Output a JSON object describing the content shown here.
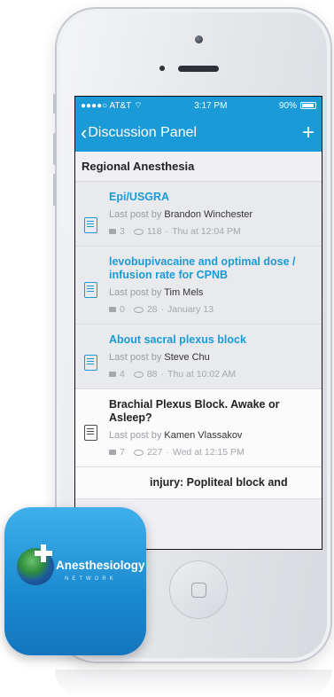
{
  "status_bar": {
    "carrier": "●●●●○ AT&T",
    "time": "3:17 PM",
    "battery": "90%"
  },
  "navbar": {
    "back_label": "Discussion Panel",
    "add_label": "+"
  },
  "section": {
    "title": "Regional Anesthesia"
  },
  "threads": [
    {
      "title": "Epi/USGRA",
      "last_post_prefix": "Last post by",
      "author": "Brandon Winchester",
      "replies": "3",
      "views": "118",
      "date": "Thu at 12:04 PM"
    },
    {
      "title": "levobupivacaine and optimal dose / infusion rate for CPNB",
      "last_post_prefix": "Last post by",
      "author": "Tim Mels",
      "replies": "0",
      "views": "28",
      "date": "January 13"
    },
    {
      "title": "About sacral plexus block",
      "last_post_prefix": "Last post by",
      "author": "Steve Chu",
      "replies": "4",
      "views": "88",
      "date": "Thu at 10:02 AM"
    },
    {
      "title": "Brachial Plexus Block. Awake or Asleep?",
      "last_post_prefix": "Last post by",
      "author": "Kamen Vlassakov",
      "replies": "7",
      "views": "227",
      "date": "Wed at 12:15 PM"
    },
    {
      "title": "injury: Popliteal block and",
      "last_post_prefix": "",
      "author": "",
      "replies": "",
      "views": "",
      "date": ""
    }
  ],
  "app_icon": {
    "name": "Anesthesiology",
    "subtitle": "NETWORK"
  },
  "colors": {
    "accent": "#1a9bd7"
  }
}
